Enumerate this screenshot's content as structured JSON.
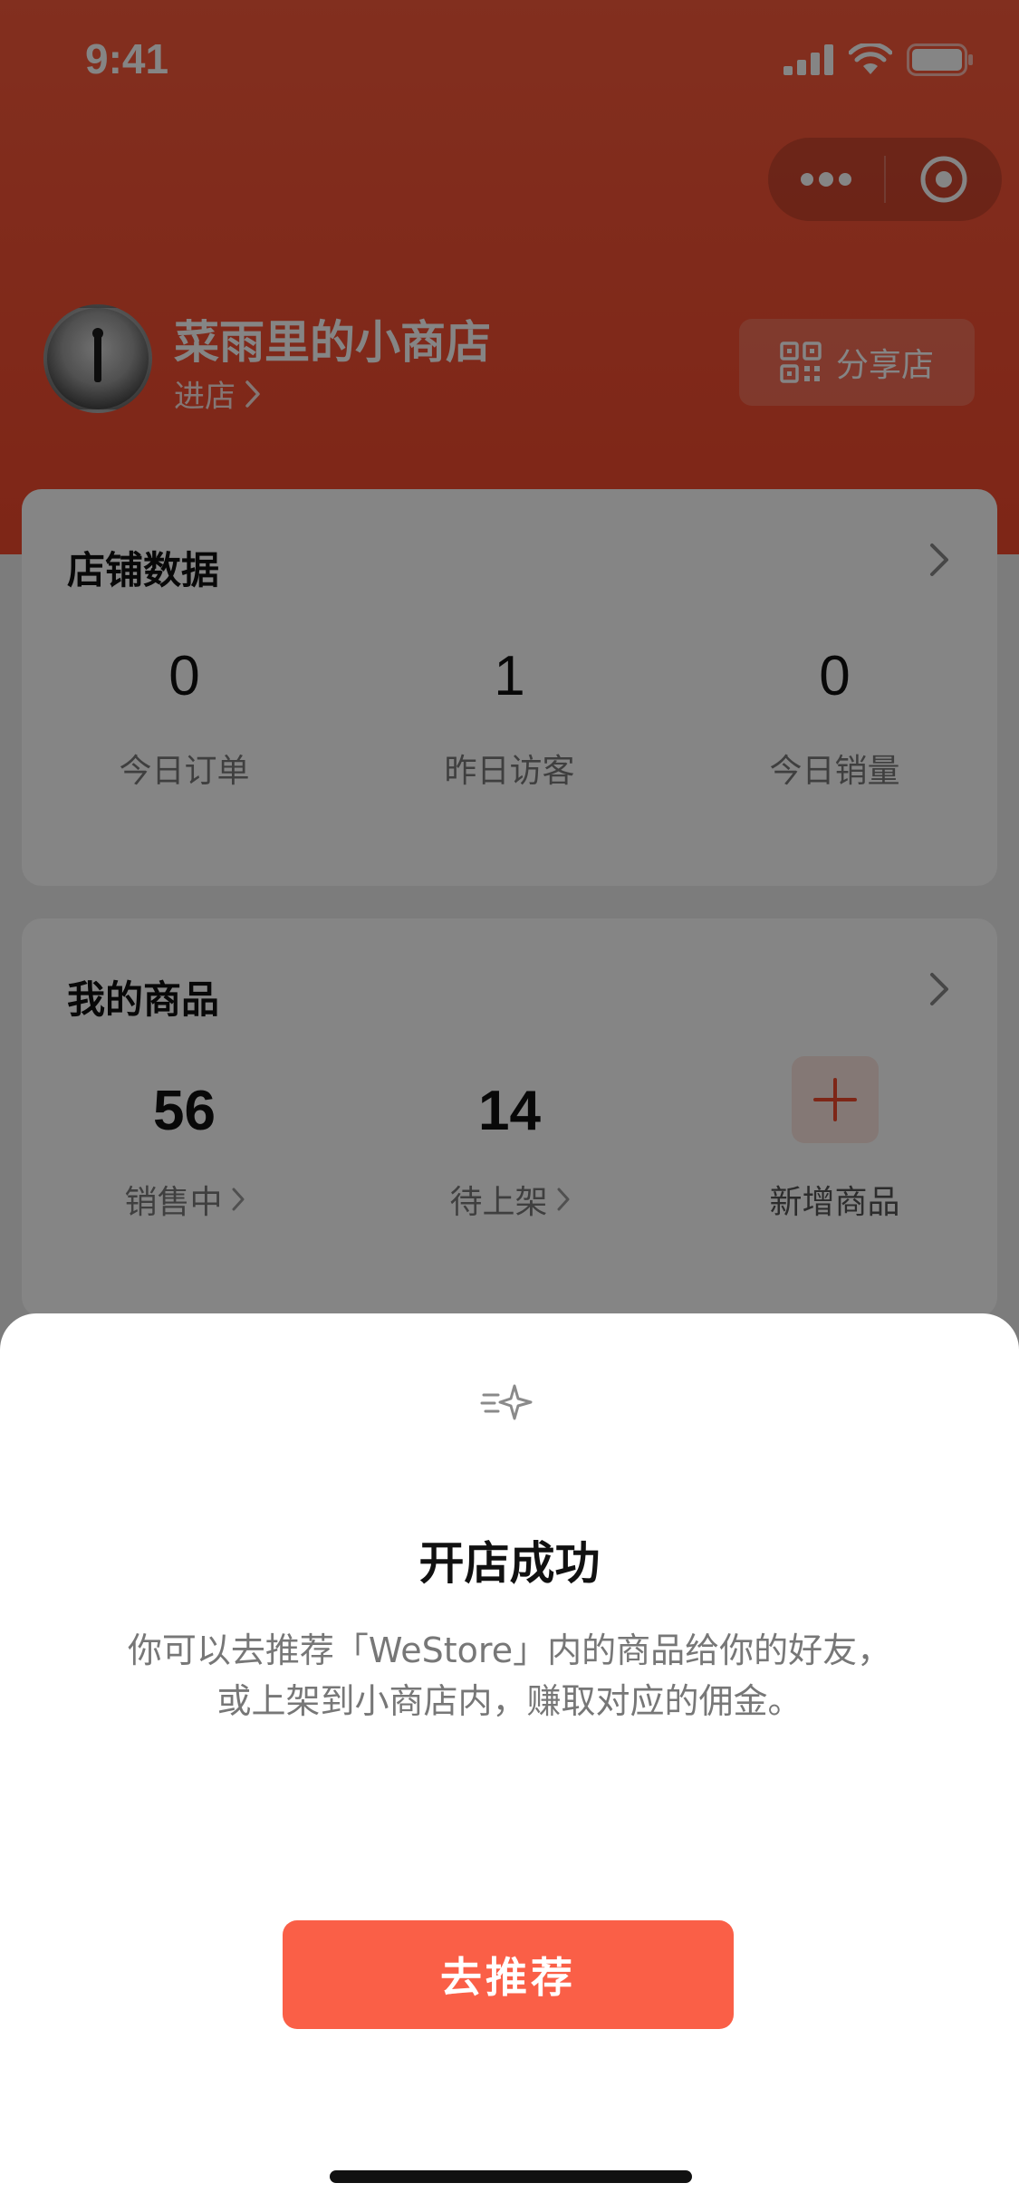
{
  "status_bar": {
    "time": "9:41"
  },
  "header": {
    "store_name": "菜雨里的小商店",
    "enter_store": "进店",
    "share_store": "分享店"
  },
  "store_data": {
    "title": "店铺数据",
    "stats": [
      {
        "value": "0",
        "label": "今日订单"
      },
      {
        "value": "1",
        "label": "昨日访客"
      },
      {
        "value": "0",
        "label": "今日销量"
      }
    ]
  },
  "my_goods": {
    "title": "我的商品",
    "stats": [
      {
        "value": "56",
        "label": "销售中"
      },
      {
        "value": "14",
        "label": "待上架"
      }
    ],
    "add_label": "新增商品"
  },
  "sheet": {
    "title": "开店成功",
    "desc_line1": "你可以去推荐「WeStore」内的商品给你的好友，",
    "desc_line2": "或上架到小商店内，赚取对应的佣金。",
    "button": "去推荐"
  },
  "colors": {
    "brand": "#f2492c",
    "button": "#fa5f47",
    "add_bg": "#fde6e1"
  },
  "icons": {
    "signal": "cellular-signal-icon",
    "wifi": "wifi-icon",
    "battery": "battery-icon",
    "more": "more-dots-icon",
    "target": "target-icon",
    "qr": "qr-code-icon",
    "chevron": "chevron-right-icon",
    "plus": "plus-icon",
    "sparkle": "sparkle-icon"
  }
}
